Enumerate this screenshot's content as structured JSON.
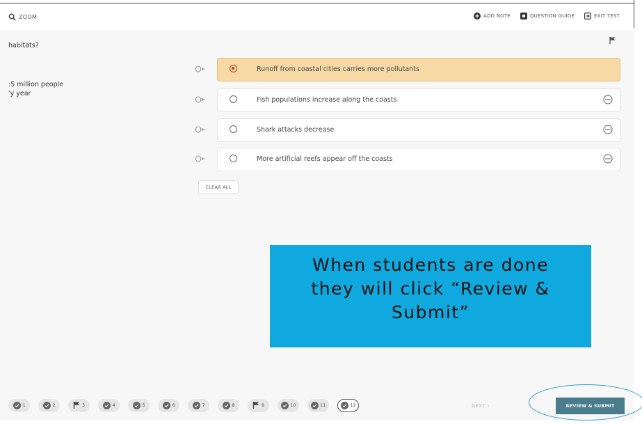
{
  "header": {
    "zoom_label": "ZOOM",
    "tools": [
      {
        "label": "ADD NOTE",
        "icon": "plus-circle-icon"
      },
      {
        "label": "QUESTION GUIDE",
        "icon": "guide-icon"
      },
      {
        "label": "EXIT TEST",
        "icon": "exit-icon"
      }
    ]
  },
  "question": {
    "text": "habitats?",
    "passage_lines": [
      ":5 million people",
      "'y year"
    ]
  },
  "choices": [
    {
      "text": "Runoff from coastal cities carries more pollutants",
      "selected": true
    },
    {
      "text": "Fish populations increase along the coasts",
      "selected": false
    },
    {
      "text": "Shark attacks decrease",
      "selected": false
    },
    {
      "text": "More artificial reefs appear off the coasts",
      "selected": false
    }
  ],
  "clear_all_label": "CLEAR ALL",
  "callout": {
    "lines": [
      "When students are done",
      "they will click “Review &",
      "Submit”"
    ],
    "color": "#0fa9df"
  },
  "footer": {
    "questions": [
      {
        "number": "1",
        "state": "answered"
      },
      {
        "number": "2",
        "state": "answered"
      },
      {
        "number": "3",
        "state": "flagged"
      },
      {
        "number": "4",
        "state": "answered"
      },
      {
        "number": "5",
        "state": "answered"
      },
      {
        "number": "6",
        "state": "answered"
      },
      {
        "number": "7",
        "state": "answered"
      },
      {
        "number": "8",
        "state": "answered"
      },
      {
        "number": "9",
        "state": "flagged"
      },
      {
        "number": "10",
        "state": "answered"
      },
      {
        "number": "11",
        "state": "answered"
      },
      {
        "number": "12",
        "state": "current"
      }
    ],
    "next_label": "NEXT ›",
    "review_label": "REVIEW & SUBMIT",
    "review_color": "#4a7d8c"
  }
}
